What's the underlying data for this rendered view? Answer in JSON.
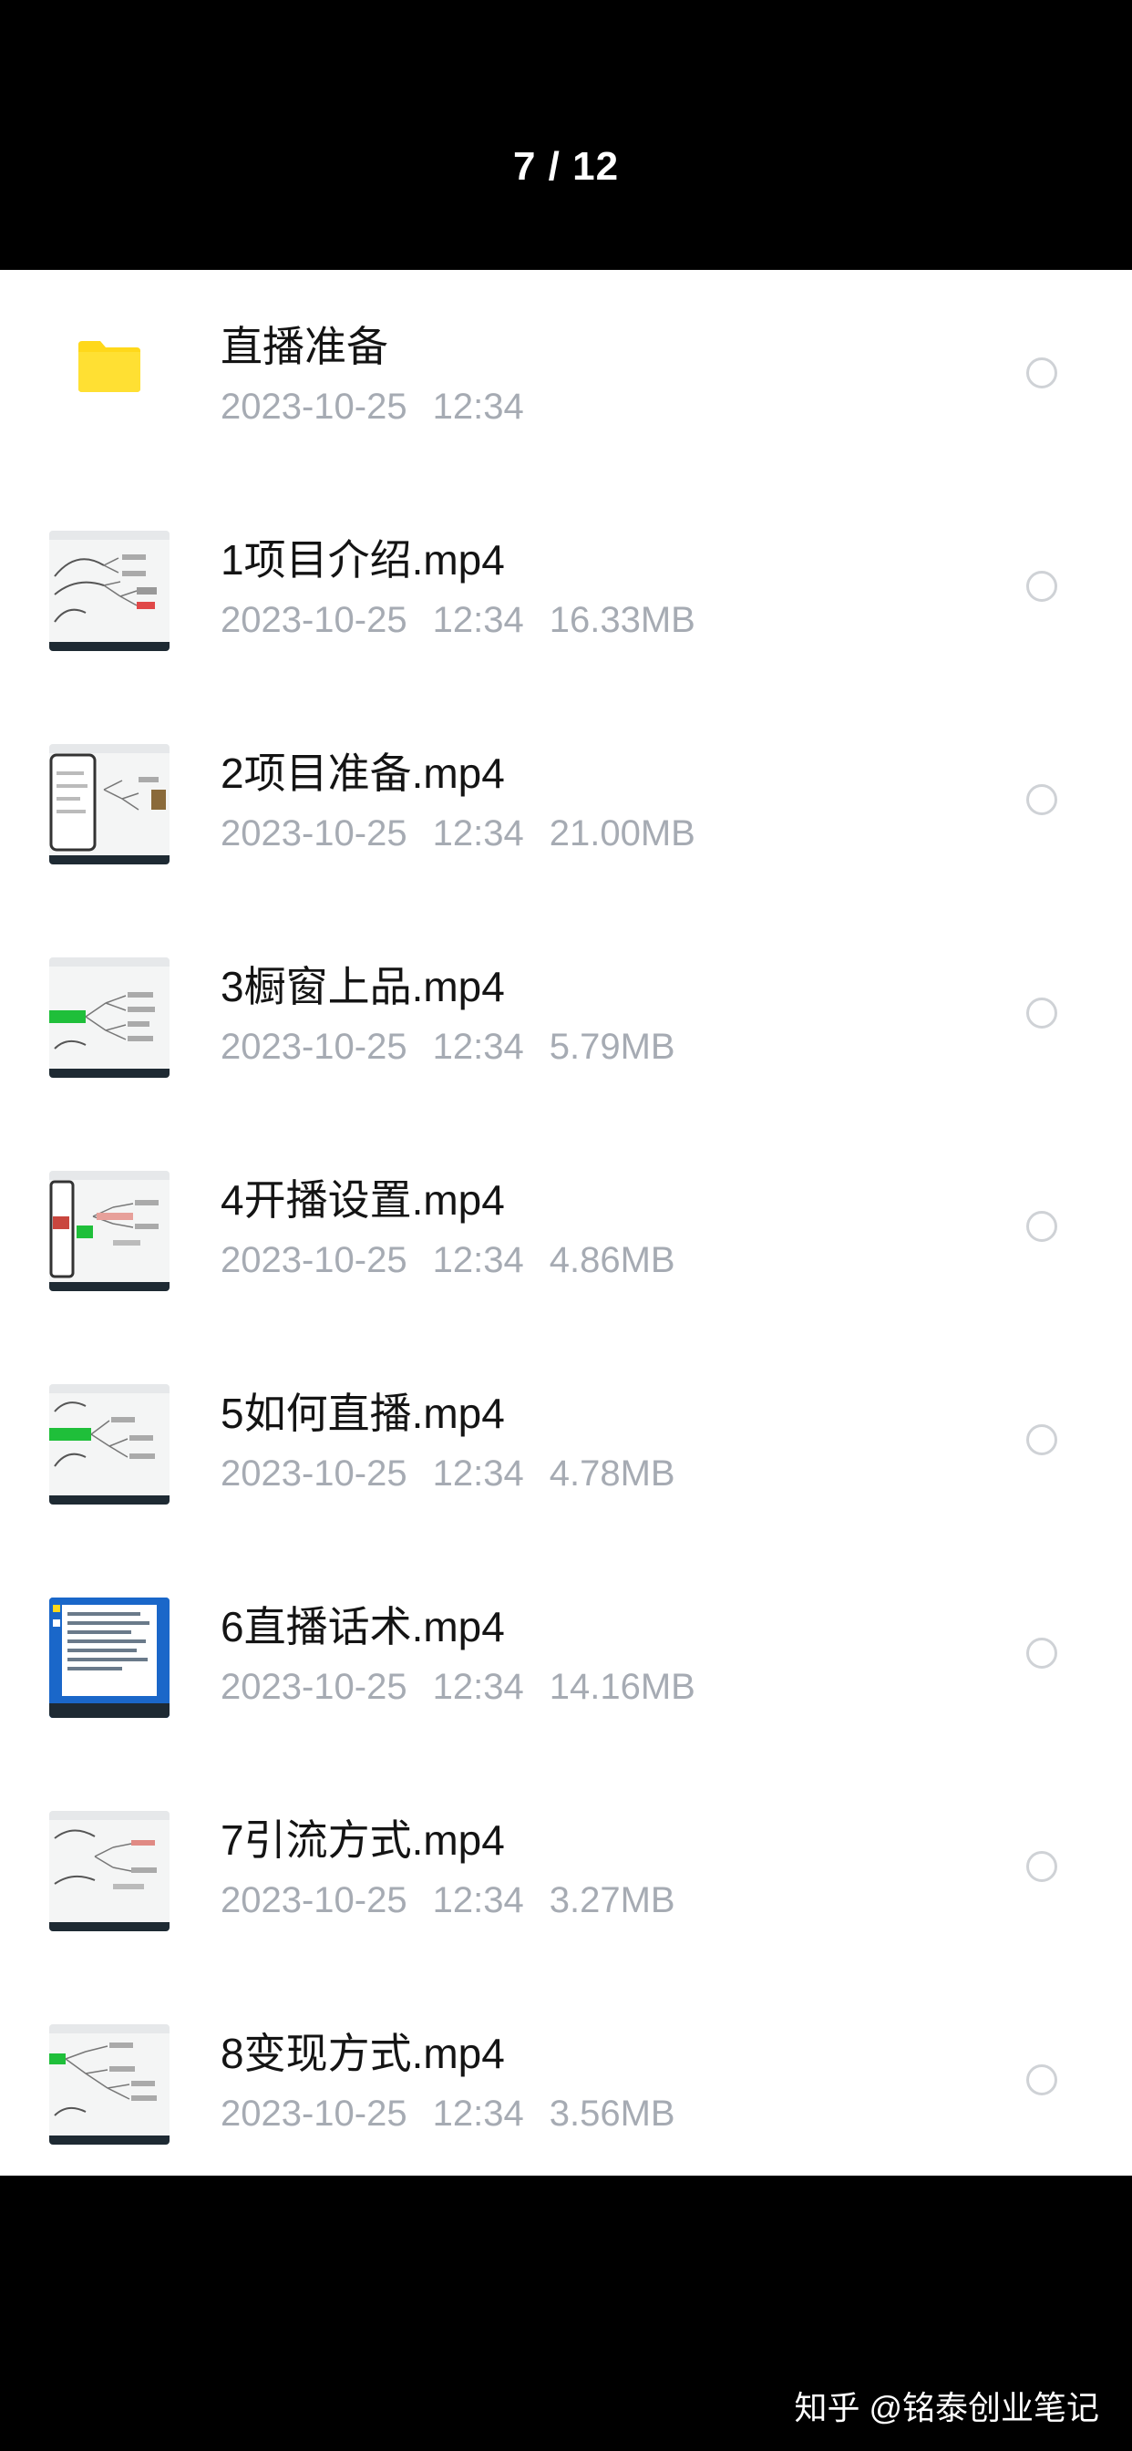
{
  "header": {
    "page_counter": "7 / 12"
  },
  "files": [
    {
      "name": "直播准备",
      "date": "2023-10-25",
      "time": "12:34",
      "size": "",
      "icon": "folder-icon",
      "thumb": "folder"
    },
    {
      "name": "1项目介绍.mp4",
      "date": "2023-10-25",
      "time": "12:34",
      "size": "16.33MB",
      "icon": "video-thumbnail",
      "thumb": "mindmap"
    },
    {
      "name": "2项目准备.mp4",
      "date": "2023-10-25",
      "time": "12:34",
      "size": "21.00MB",
      "icon": "video-thumbnail",
      "thumb": "phone-mindmap"
    },
    {
      "name": "3橱窗上品.mp4",
      "date": "2023-10-25",
      "time": "12:34",
      "size": "5.79MB",
      "icon": "video-thumbnail",
      "thumb": "green-mindmap"
    },
    {
      "name": "4开播设置.mp4",
      "date": "2023-10-25",
      "time": "12:34",
      "size": "4.86MB",
      "icon": "video-thumbnail",
      "thumb": "phone-red-mindmap"
    },
    {
      "name": "5如何直播.mp4",
      "date": "2023-10-25",
      "time": "12:34",
      "size": "4.78MB",
      "icon": "video-thumbnail",
      "thumb": "green-mindmap"
    },
    {
      "name": "6直播话术.mp4",
      "date": "2023-10-25",
      "time": "12:34",
      "size": "14.16MB",
      "icon": "video-thumbnail",
      "thumb": "blue-document"
    },
    {
      "name": "7引流方式.mp4",
      "date": "2023-10-25",
      "time": "12:34",
      "size": "3.27MB",
      "icon": "video-thumbnail",
      "thumb": "mindmap"
    },
    {
      "name": "8变现方式.mp4",
      "date": "2023-10-25",
      "time": "12:34",
      "size": "3.56MB",
      "icon": "video-thumbnail",
      "thumb": "green-mindmap"
    }
  ],
  "watermark": "知乎 @铭泰创业笔记",
  "colors": {
    "folder": "#ffd81a",
    "title_text": "#141414",
    "meta_text": "#a6abb3",
    "radio_border": "#cfd2d6",
    "background": "#000000",
    "panel": "#ffffff"
  }
}
